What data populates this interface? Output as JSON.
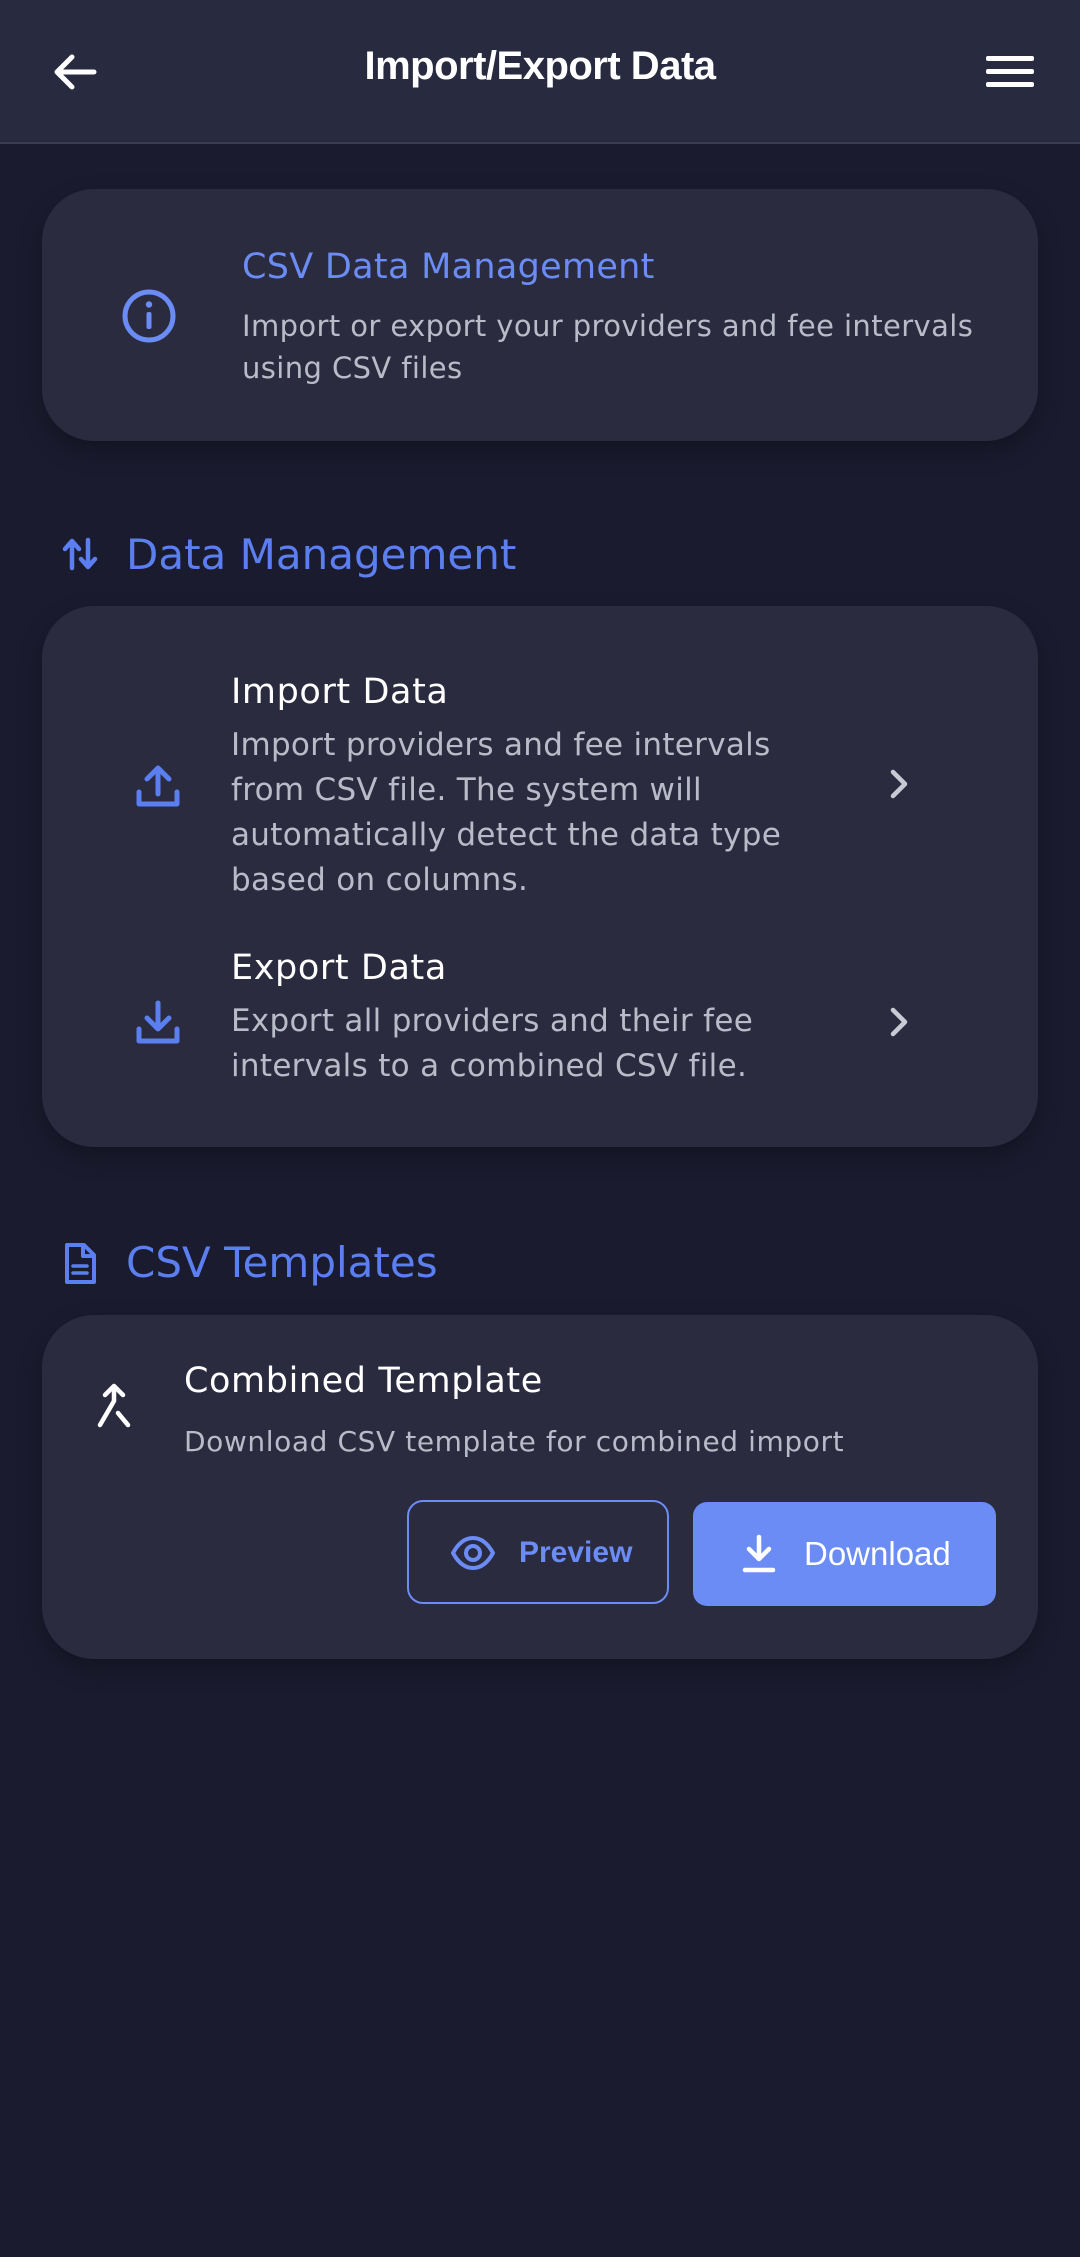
{
  "app_bar": {
    "title": "Import/Export Data"
  },
  "info_card": {
    "title": "CSV Data Management",
    "description": "Import or export your providers and fee intervals using CSV files"
  },
  "data_management": {
    "section_title": "Data Management",
    "items": [
      {
        "title": "Import Data",
        "description": "Import providers and fee intervals from CSV file. The system will automatically detect the data type based on columns."
      },
      {
        "title": "Export Data",
        "description": "Export all providers and their fee intervals to a combined CSV file."
      }
    ]
  },
  "csv_templates": {
    "section_title": "CSV Templates",
    "template": {
      "title": "Combined Template",
      "description": "Download CSV template for combined import",
      "preview_label": "Preview",
      "download_label": "Download"
    }
  },
  "colors": {
    "background": "#1a1b2e",
    "app_bar": "#282a3f",
    "card": "#2a2b3f",
    "accent": "#6b8cf5",
    "section_accent": "#5b7ff0",
    "muted_text": "#b9bcc8"
  },
  "icons": {
    "back": "arrow-left-icon",
    "menu": "hamburger-menu-icon",
    "info": "info-circle-icon",
    "data_management": "swap-vertical-icon",
    "import": "upload-icon",
    "export": "download-icon",
    "chevron": "chevron-right-icon",
    "csv_templates": "document-icon",
    "combined_template": "merge-icon",
    "preview": "eye-icon",
    "download_button": "download-icon"
  }
}
